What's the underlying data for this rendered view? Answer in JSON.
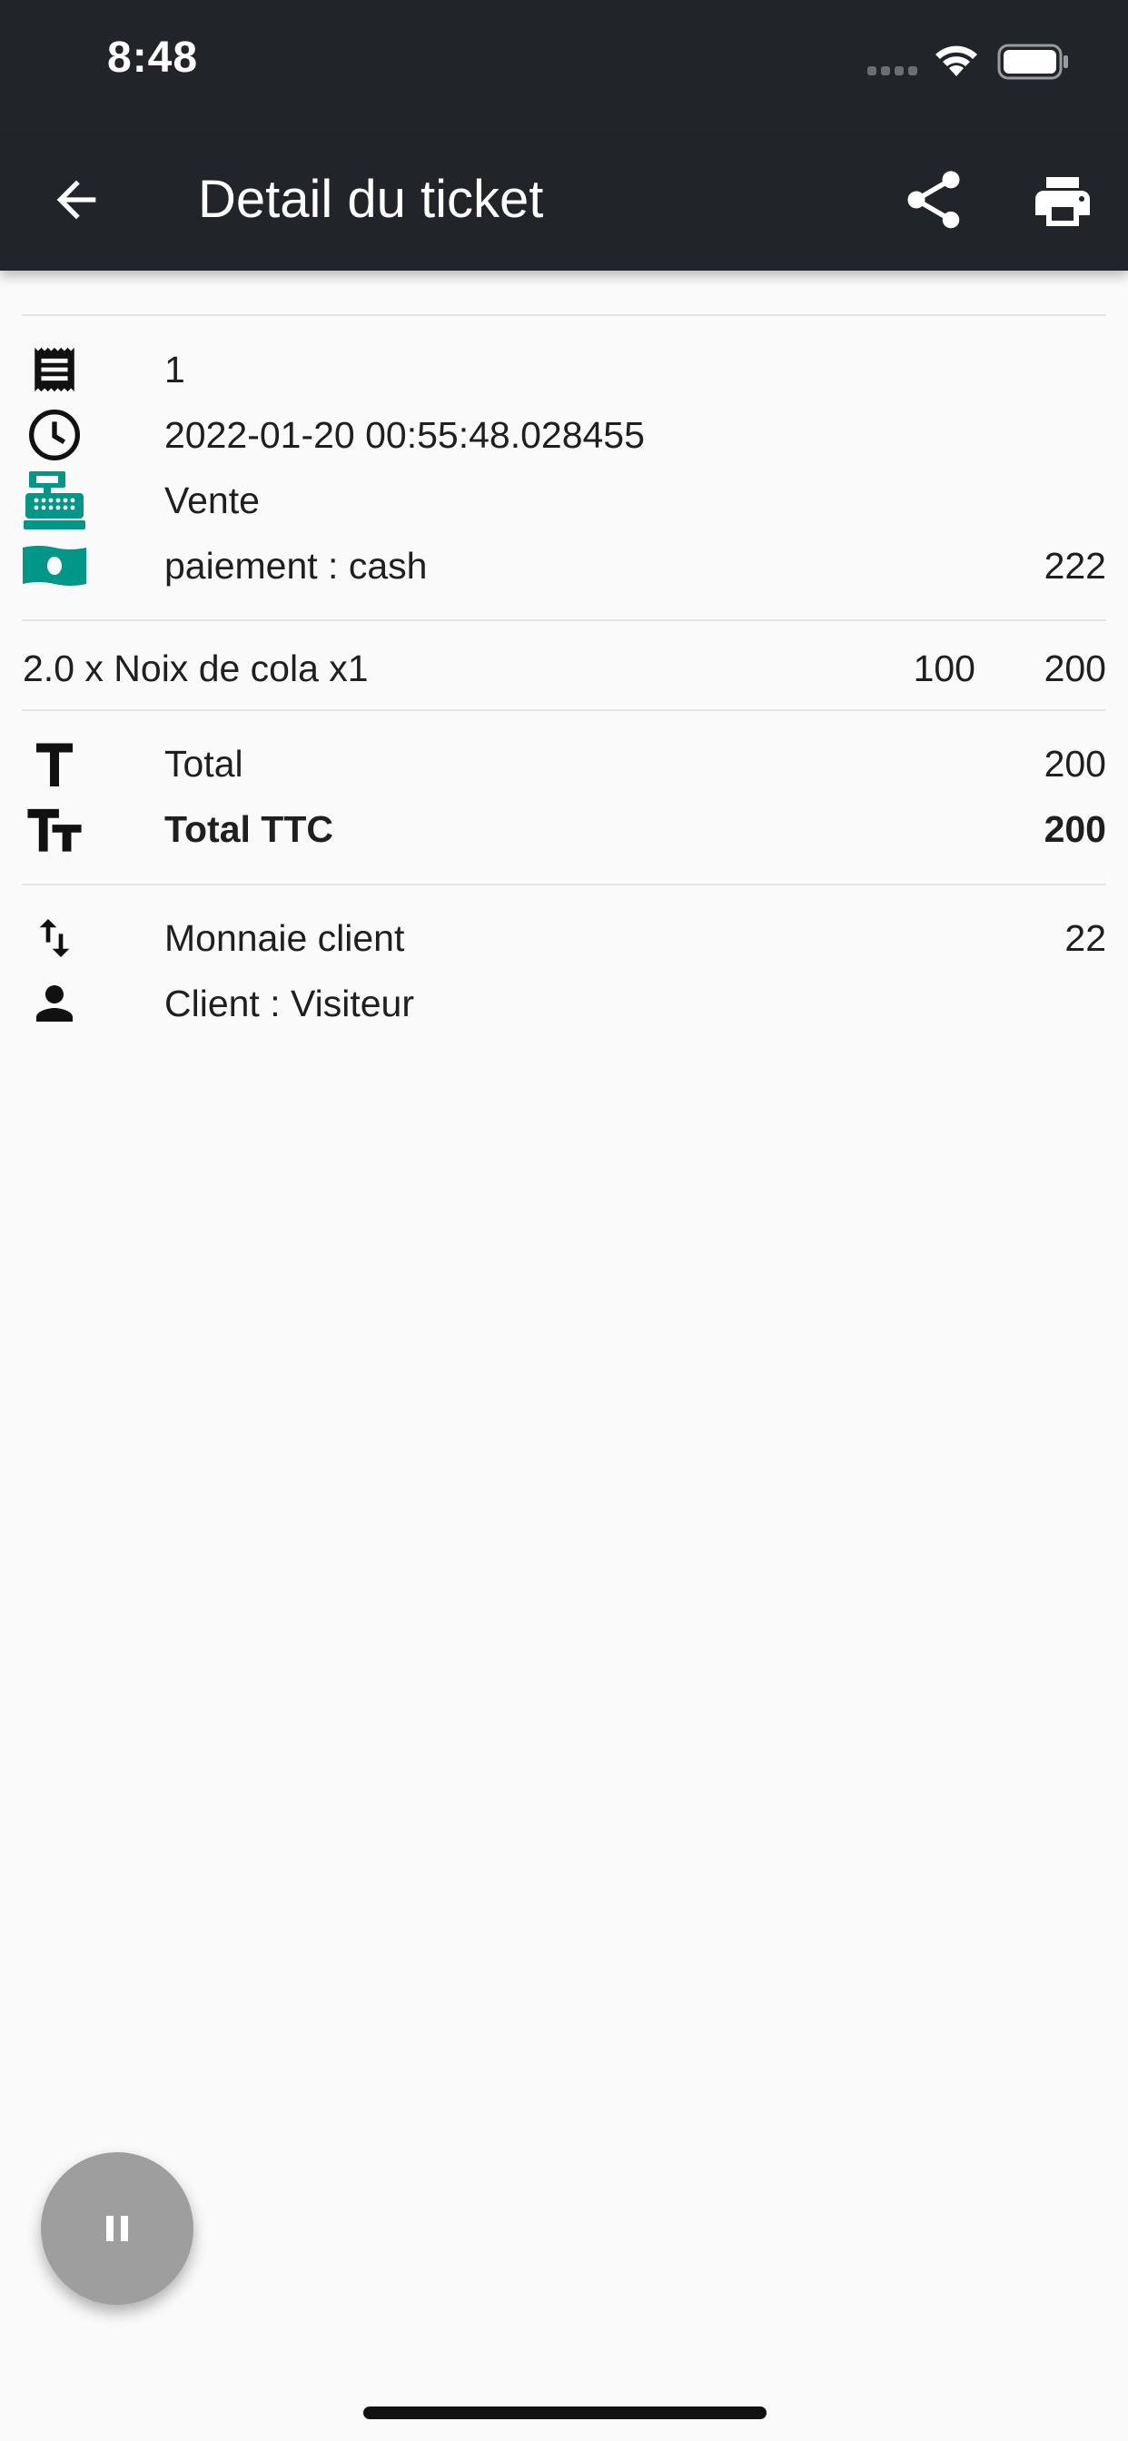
{
  "status_bar": {
    "time": "8:48"
  },
  "app_bar": {
    "title": "Detail du ticket"
  },
  "ticket": {
    "number": "1",
    "datetime": "2022-01-20 00:55:48.028455",
    "type": "Vente",
    "payment_label": "paiement : cash",
    "payment_amount": "222"
  },
  "items": [
    {
      "name": "2.0 x Noix de cola x1",
      "unit_price": "100",
      "line_total": "200"
    }
  ],
  "totals": {
    "total_label": "Total",
    "total_value": "200",
    "total_ttc_label": "Total TTC",
    "total_ttc_value": "200"
  },
  "footer": {
    "change_label": "Monnaie client",
    "change_value": "22",
    "client_label": "Client : Visiteur"
  },
  "icons": {
    "receipt": "receipt-icon",
    "clock": "clock-icon",
    "register": "cash-register-icon",
    "money": "money-icon",
    "total": "text-t-icon",
    "total_ttc": "text-fields-icon",
    "change": "swap-vert-icon",
    "client": "person-icon"
  },
  "colors": {
    "app_bar": "#212529",
    "accent": "#009688",
    "fab": "#9e9e9e"
  }
}
